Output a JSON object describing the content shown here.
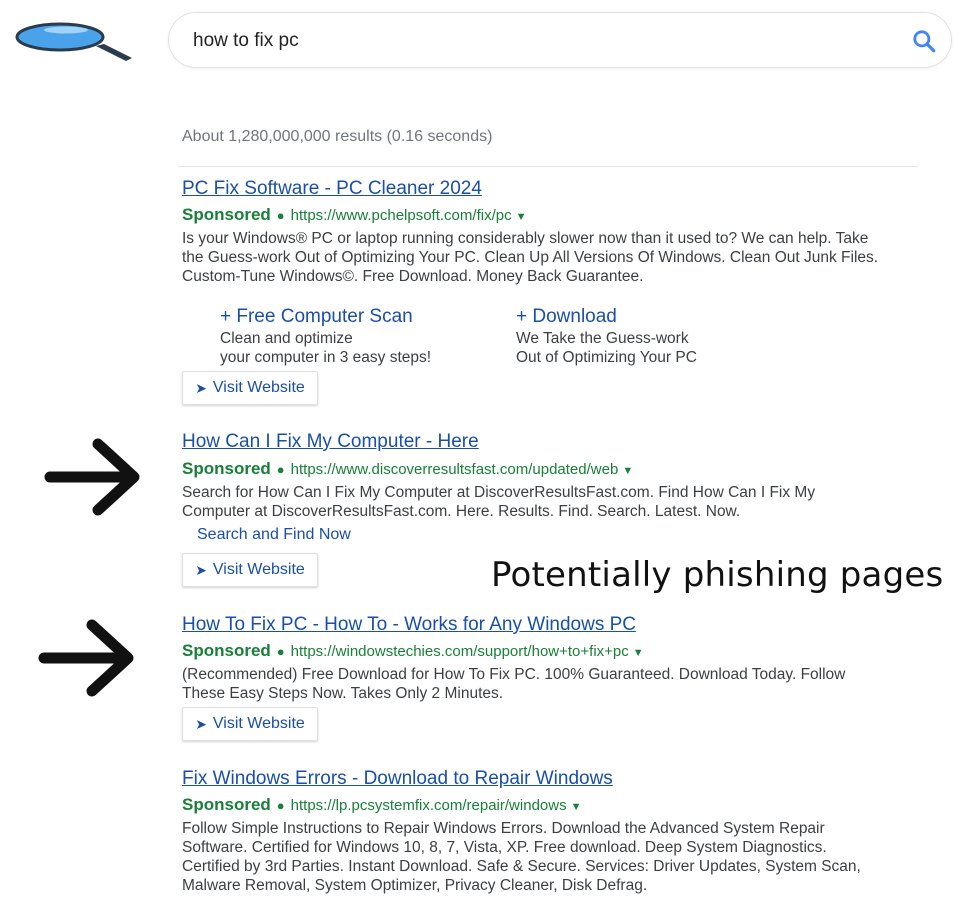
{
  "search": {
    "query": "how to fix pc"
  },
  "stats": "About 1,280,000,000 results (0.16 seconds)",
  "results": [
    {
      "title": "PC Fix Software - PC Cleaner 2024",
      "label": "Sponsored",
      "url": "https://www.pchelpsoft.com/fix/pc",
      "desc": [
        "Is your Windows® PC or laptop running considerably slower now than it used to? We can help. Take",
        "the Guess-work Out of Optimizing Your PC. Clean Up All Versions Of Windows. Clean Out Junk Files.",
        "Custom-Tune Windows©. Free Download. Money Back Guarantee."
      ],
      "sitelinks": [
        {
          "title": "+ Free Computer Scan",
          "lines": [
            "Clean and optimize",
            "your computer in 3 easy steps!"
          ]
        },
        {
          "title": "+ Download",
          "lines": [
            "We Take the Guess-work",
            "Out of Optimizing Your PC"
          ]
        }
      ],
      "visit": "Visit Website"
    },
    {
      "title": "How Can I Fix My Computer - Here",
      "label": "Sponsored",
      "url": "https://www.discoverresultsfast.com/updated/web",
      "desc": [
        "Search for How Can I Fix My Computer at DiscoverResultsFast.com. Find How Can I Fix My",
        "Computer at DiscoverResultsFast.com. Here. Results. Find. Search. Latest. Now."
      ],
      "extra_link": "Search and Find Now",
      "visit": "Visit Website"
    },
    {
      "title": "How To Fix PC - How To - Works for Any Windows PC",
      "label": "Sponsored",
      "url": "https://windowstechies.com/support/how+to+fix+pc",
      "desc": [
        "(Recommended) Free Download for How To Fix PC. 100% Guaranteed. Download Today. Follow",
        "These Easy Steps Now. Takes Only 2 Minutes."
      ],
      "visit": "Visit Website"
    },
    {
      "title": "Fix Windows Errors - Download to Repair Windows",
      "label": "Sponsored",
      "url": "https://lp.pcsystemfix.com/repair/windows",
      "desc": [
        "Follow Simple Instructions to Repair Windows Errors. Download the Advanced System Repair",
        "Software. Certified for Windows 10, 8, 7, Vista, XP. Free download. Deep System Diagnostics.",
        "Certified by 3rd Parties. Instant Download. Safe & Secure. Services: Driver Updates, System Scan,",
        "Malware Removal, System Optimizer, Privacy Cleaner, Disk Defrag."
      ]
    }
  ],
  "annotation": "Potentially phishing pages",
  "colors": {
    "link": "#1a4fa8",
    "sponsored": "#188038",
    "text": "#3c4043",
    "stats": "#70757a"
  }
}
